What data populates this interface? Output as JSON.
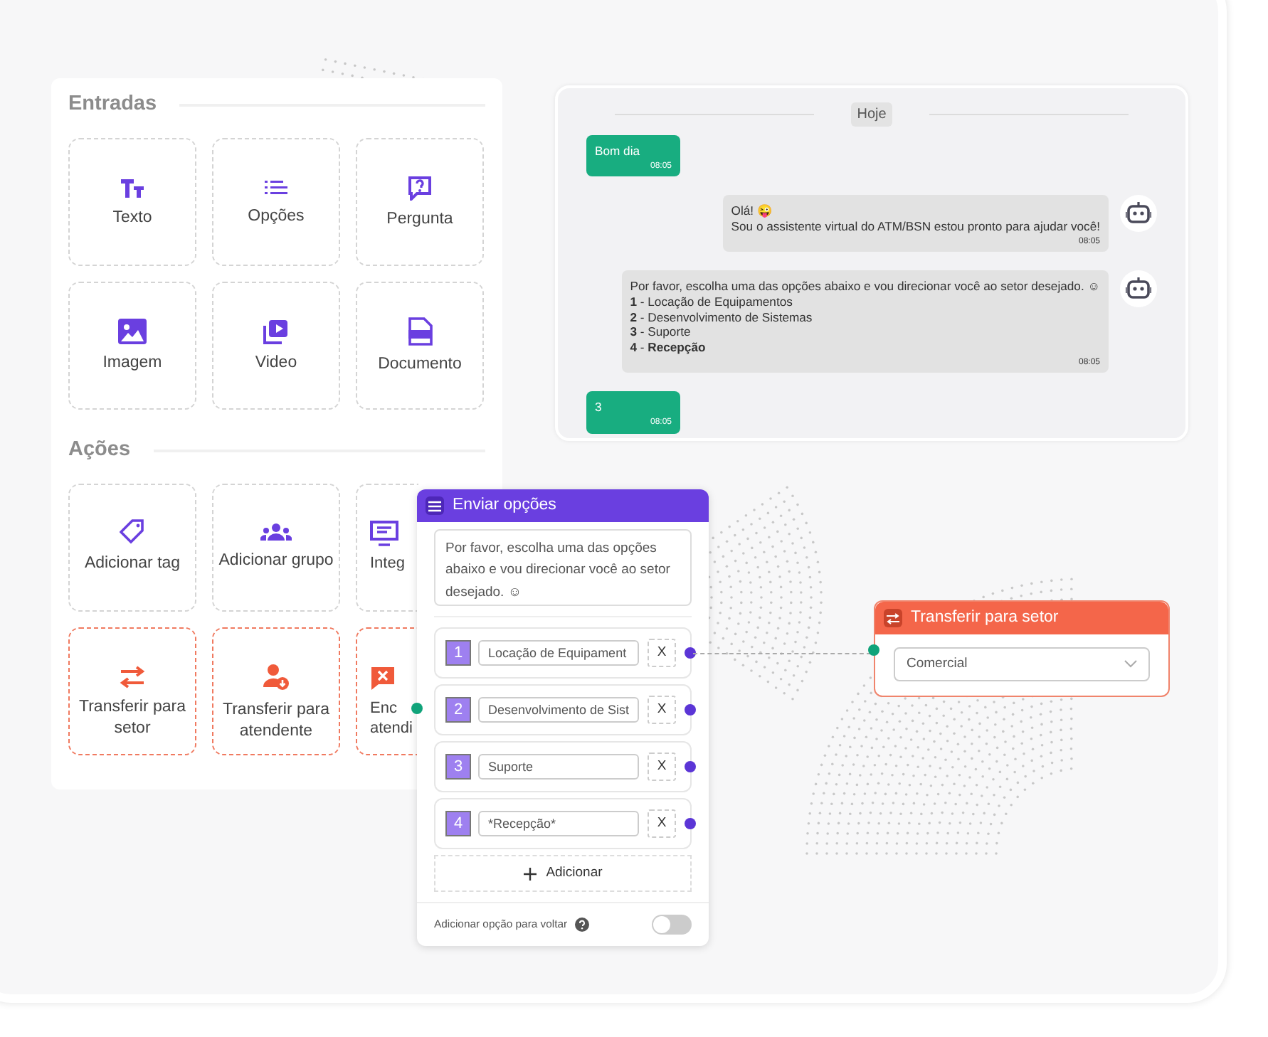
{
  "palette": {
    "sections": [
      {
        "title": "Entradas",
        "tiles": [
          {
            "label": "Texto",
            "kind": "input"
          },
          {
            "label": "Opções",
            "kind": "input"
          },
          {
            "label": "Pergunta",
            "kind": "input"
          },
          {
            "label": "Imagem",
            "kind": "input"
          },
          {
            "label": "Video",
            "kind": "input"
          },
          {
            "label": "Documento",
            "kind": "input"
          }
        ]
      },
      {
        "title": "Ações",
        "tiles": [
          {
            "label": "Adicionar tag",
            "kind": "action"
          },
          {
            "label": "Adicionar grupo",
            "kind": "action"
          },
          {
            "label": "Integ",
            "kind": "action_partial"
          },
          {
            "label": "Transferir para setor",
            "kind": "transfer"
          },
          {
            "label": "Transferir para atendente",
            "kind": "transfer"
          },
          {
            "label": "Enc\natendi",
            "kind": "transfer_partial"
          }
        ]
      }
    ]
  },
  "chat": {
    "day": "Hoje",
    "messages": [
      {
        "kind": "user",
        "lines": [
          "Bom dia"
        ],
        "time": "08:05"
      },
      {
        "kind": "bot",
        "lines": [
          "Olá! 😜",
          "Sou o assistente virtual do ATM/BSN estou pronto para ajudar você!"
        ],
        "time": "08:05"
      },
      {
        "kind": "bot",
        "lines": [
          "Por favor, escolha uma das opções abaixo e vou direcionar você ao setor desejado. ☺",
          "**1** - Locação de Equipamentos",
          "**2** - Desenvolvimento de Sistemas",
          "**3** - Suporte",
          "**4** - **Recepção**"
        ],
        "time": "08:05"
      },
      {
        "kind": "user",
        "lines": [
          "3"
        ],
        "time": "08:05"
      }
    ]
  },
  "options_node": {
    "title": "Enviar opções",
    "message": "Por favor, escolha uma das opções abaixo e vou direcionar você ao setor desejado. ☺",
    "options": [
      {
        "number": "1",
        "value": "Locação de Equipament",
        "remove": "X",
        "connected": true
      },
      {
        "number": "2",
        "value": "Desenvolvimento de Sist",
        "remove": "X",
        "connected": false
      },
      {
        "number": "3",
        "value": "Suporte",
        "remove": "X",
        "connected": false
      },
      {
        "number": "4",
        "value": "*Recepção*",
        "remove": "X",
        "connected": false
      }
    ],
    "add_button": "Adicionar",
    "back_option": {
      "label": "Adicionar opção para voltar",
      "on": false
    }
  },
  "transfer_node": {
    "title": "Transferir para setor",
    "sector": "Comercial"
  }
}
